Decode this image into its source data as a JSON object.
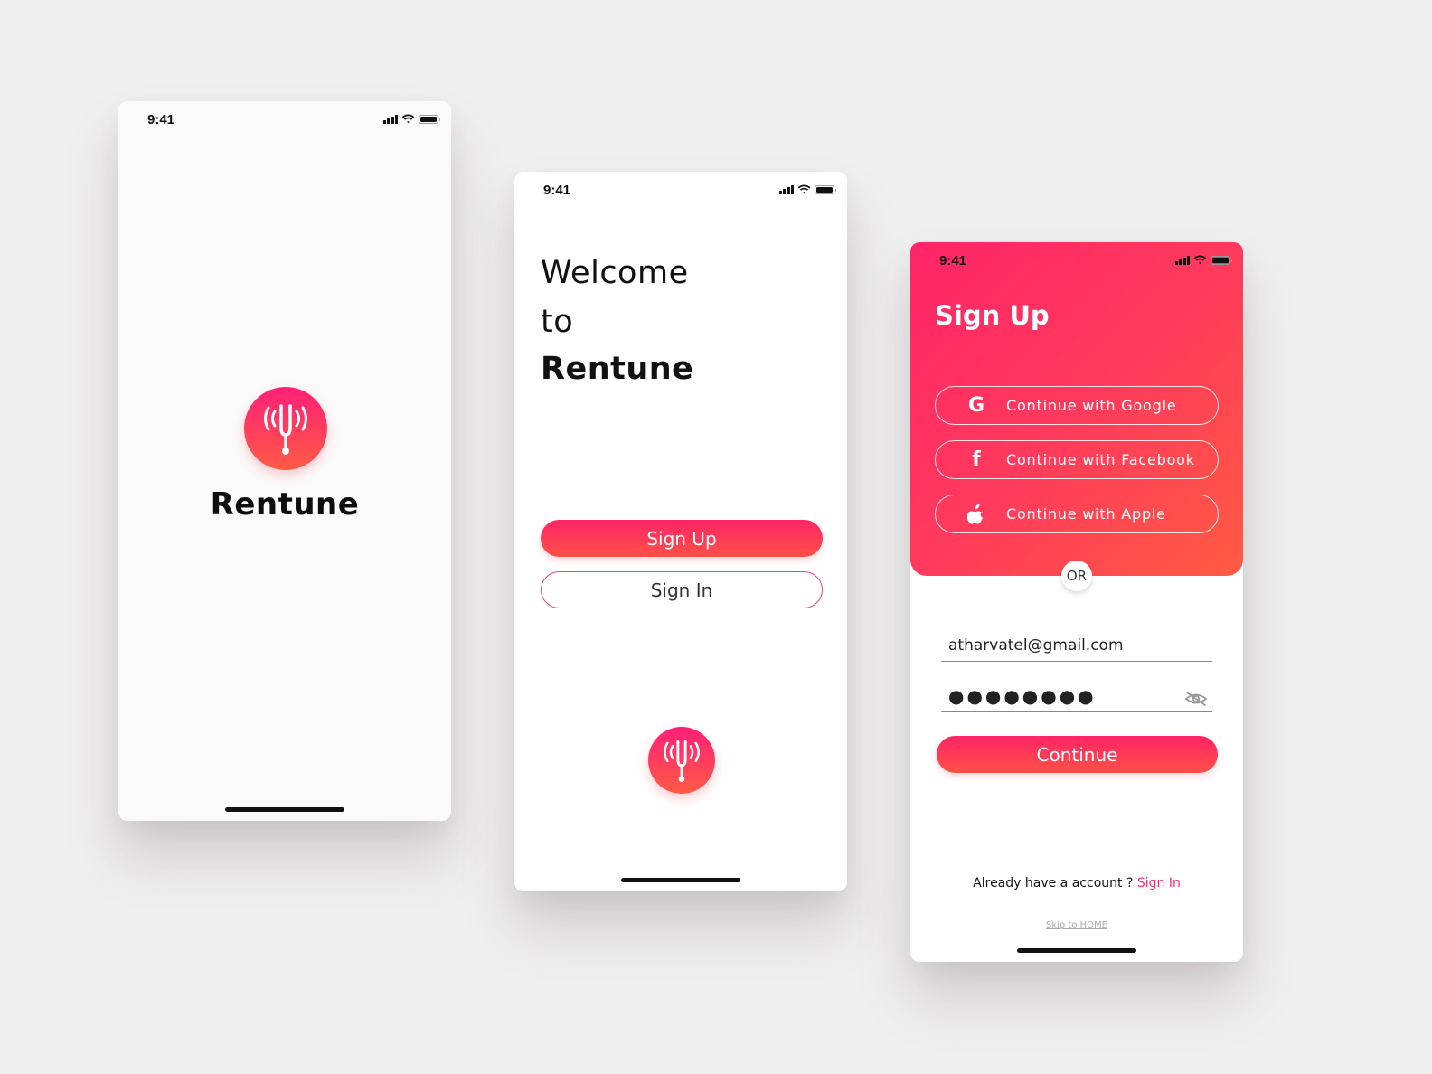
{
  "screens": {
    "splash": {
      "status_time": "9:41",
      "brand_name": "Rentune",
      "logo_icon": "tuning-fork-icon"
    },
    "welcome": {
      "status_time": "9:41",
      "heading_line1": "Welcome",
      "heading_line2": "to",
      "heading_line3": "Rentune",
      "sign_up_label": "Sign Up",
      "sign_in_label": "Sign In",
      "logo_icon": "tuning-fork-icon"
    },
    "signup": {
      "status_time": "9:41",
      "title": "Sign Up",
      "social": [
        {
          "icon": "google-icon",
          "glyph": "G",
          "label": "Continue with Google"
        },
        {
          "icon": "facebook-icon",
          "glyph": "f",
          "label": "Continue with Facebook"
        },
        {
          "icon": "apple-icon",
          "glyph": "",
          "label": "Continue with Apple"
        }
      ],
      "or_label": "OR",
      "email_value": "atharvatel@gmail.com",
      "password_value": "●●●●●●●●",
      "continue_label": "Continue",
      "already_text": "Already have a account ? ",
      "sign_in_link": "Sign In",
      "skip_label": "Skip to HOME"
    }
  },
  "colors": {
    "brand_pink": "#ff1f78",
    "brand_orange": "#ff5a45",
    "background": "#f0efef",
    "link": "#ff2a73"
  }
}
